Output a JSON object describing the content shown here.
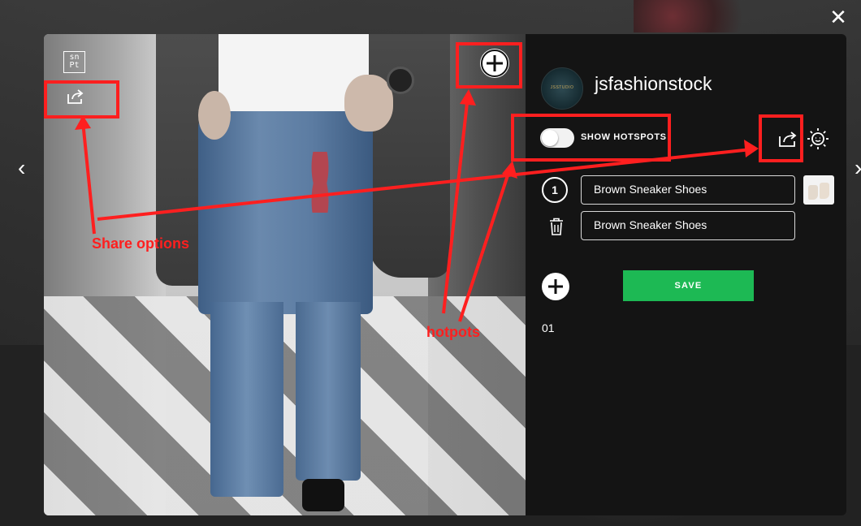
{
  "modal": {
    "close_glyph": "✕",
    "prev_glyph": "‹",
    "next_glyph": "›",
    "logo_text_line1": "sn",
    "logo_text_line2": "Pt"
  },
  "profile": {
    "username": "jsfashionstock",
    "avatar_text": "JSSTUDIO"
  },
  "hotspots": {
    "toggle_label": "SHOW HOTSPOTS",
    "toggle_on": false,
    "item_number": "1",
    "product_name": "Brown Sneaker Shoes",
    "product_caption": "Brown Sneaker Shoes",
    "save_label": "SAVE",
    "counter": "01"
  },
  "annotations": {
    "share_label": "Share options",
    "hotspots_label": "hotpots",
    "color": "#ff1f1f"
  },
  "colors": {
    "panel_bg": "#141414",
    "save_green": "#1db954"
  }
}
